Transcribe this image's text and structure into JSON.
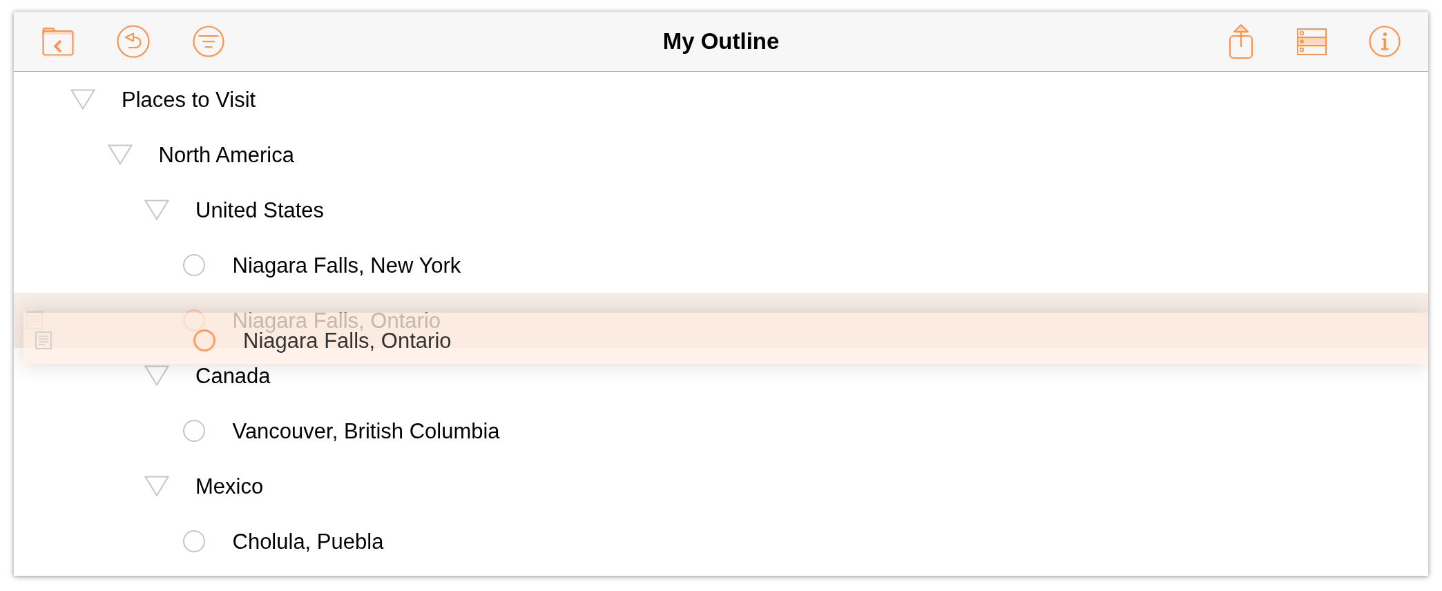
{
  "window": {
    "title": "My Outline"
  },
  "outline": {
    "rows": [
      {
        "text": "Places to Visit",
        "expanded": true,
        "dragging": false,
        "children": [
          {
            "text": "North America",
            "expanded": true,
            "dragging": false,
            "children": [
              {
                "text": "United States",
                "expanded": true,
                "dragging": false,
                "children": [
                  {
                    "text": "Niagara Falls, New York",
                    "dragging": false
                  },
                  {
                    "text": "Niagara Falls, Ontario",
                    "dragging": true
                  }
                ]
              },
              {
                "text": "Canada",
                "expanded": true,
                "dragging": false,
                "children": [
                  {
                    "text": "Vancouver, British Columbia",
                    "dragging": false
                  }
                ]
              },
              {
                "text": "Mexico",
                "expanded": true,
                "dragging": false,
                "children": [
                  {
                    "text": "Cholula, Puebla",
                    "dragging": false
                  }
                ]
              }
            ]
          }
        ]
      }
    ]
  },
  "drag_preview": {
    "text": "Niagara Falls, Ontario"
  }
}
